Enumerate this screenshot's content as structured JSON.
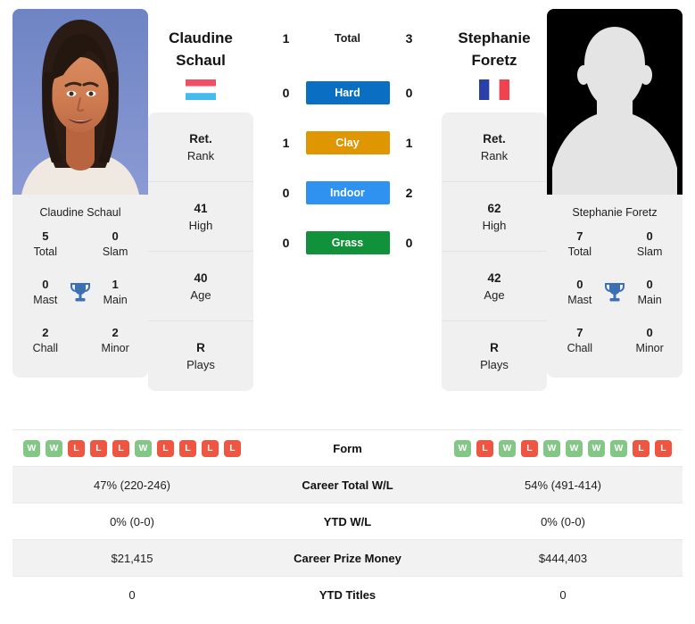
{
  "players": {
    "left": {
      "first_name": "Claudine",
      "last_name": "Schaul",
      "full_name": "Claudine Schaul",
      "country": "Luxembourg",
      "flag_icon": "flag-luxembourg",
      "photo_type": "portrait-photo",
      "info": [
        {
          "value": "Ret.",
          "label": "Rank"
        },
        {
          "value": "41",
          "label": "High"
        },
        {
          "value": "40",
          "label": "Age"
        },
        {
          "value": "R",
          "label": "Plays"
        }
      ],
      "titles": {
        "total": "5",
        "slam": "0",
        "mast": "0",
        "main": "1",
        "chall": "2",
        "minor": "2"
      },
      "form": [
        "W",
        "W",
        "L",
        "L",
        "L",
        "W",
        "L",
        "L",
        "L",
        "L"
      ],
      "career_total_wl": "47% (220-246)",
      "ytd_wl": "0% (0-0)",
      "career_prize_money": "$21,415",
      "ytd_titles": "0"
    },
    "right": {
      "first_name": "Stephanie",
      "last_name": "Foretz",
      "full_name": "Stephanie Foretz",
      "country": "France",
      "flag_icon": "flag-france",
      "photo_type": "silhouette-placeholder",
      "info": [
        {
          "value": "Ret.",
          "label": "Rank"
        },
        {
          "value": "62",
          "label": "High"
        },
        {
          "value": "42",
          "label": "Age"
        },
        {
          "value": "R",
          "label": "Plays"
        }
      ],
      "titles": {
        "total": "7",
        "slam": "0",
        "mast": "0",
        "main": "0",
        "chall": "7",
        "minor": "0"
      },
      "form": [
        "W",
        "L",
        "W",
        "L",
        "W",
        "W",
        "W",
        "W",
        "L",
        "L"
      ],
      "career_total_wl": "54% (491-414)",
      "ytd_wl": "0% (0-0)",
      "career_prize_money": "$444,403",
      "ytd_titles": "0"
    }
  },
  "titles_labels": {
    "total": "Total",
    "slam": "Slam",
    "mast": "Mast",
    "main": "Main",
    "chall": "Chall",
    "minor": "Minor",
    "trophy_icon": "trophy-icon"
  },
  "head_to_head": [
    {
      "label": "Total",
      "left": "1",
      "right": "3",
      "color": ""
    },
    {
      "label": "Hard",
      "left": "0",
      "right": "0",
      "color": "#0a6fc2"
    },
    {
      "label": "Clay",
      "left": "1",
      "right": "1",
      "color": "#e09600"
    },
    {
      "label": "Indoor",
      "left": "0",
      "right": "2",
      "color": "#2f92f0"
    },
    {
      "label": "Grass",
      "left": "0",
      "right": "0",
      "color": "#10913a"
    }
  ],
  "table": {
    "rows": [
      {
        "label": "Form",
        "left": "",
        "right": "",
        "type": "form"
      },
      {
        "label": "Career Total W/L",
        "left": "47% (220-246)",
        "right": "54% (491-414)",
        "type": "text"
      },
      {
        "label": "YTD W/L",
        "left": "0% (0-0)",
        "right": "0% (0-0)",
        "type": "text"
      },
      {
        "label": "Career Prize Money",
        "left": "$21,415",
        "right": "$444,403",
        "type": "text"
      },
      {
        "label": "YTD Titles",
        "left": "0",
        "right": "0",
        "type": "text"
      }
    ]
  },
  "colors": {
    "hard": "#0a6fc2",
    "clay": "#e09600",
    "indoor": "#2f92f0",
    "grass": "#10913a",
    "win": "#82c785",
    "loss": "#ef5540",
    "trophy": "#3d6fb4",
    "card_bg": "#f0f0f0"
  }
}
